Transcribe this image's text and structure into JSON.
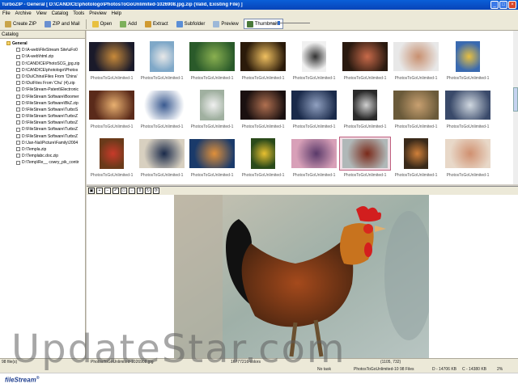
{
  "window": {
    "title": "TurboZIP - General [ D:\\CANDICE\\photologo\\PhotosToGoUnlimited-1026908.jpg.zip (Valid, Existing File) ]"
  },
  "menu": [
    "File",
    "Archive",
    "View",
    "Catalog",
    "Tools",
    "Preview",
    "Help"
  ],
  "toolbar": {
    "create_zip": "Create ZIP",
    "zip_mail": "ZIP and Mail",
    "open": "Open",
    "add": "Add",
    "extract": "Extract",
    "subfolder": "Subfolder",
    "preview": "Preview",
    "thumbnails": "Thumbnails"
  },
  "catalog": {
    "header": "Catalog",
    "root": "General",
    "items": [
      "D:\\A-web\\FileStream Site\\uFo0",
      "D:\\A-web\\html.zip",
      "D:\\CANDICE\\PhotoSCG_jpg.zip",
      "D:\\CANDICE\\photologo\\Photos",
      "D:\\Du\\China\\Files From 'China'",
      "D:\\Du\\Files From 'Chu' (4).zip",
      "D:\\FileStream-Patent\\Electronic",
      "D:\\FileStream Software\\Boomer",
      "D:\\FileStream Software\\BkZ.zip",
      "D:\\FileStream Software\\TurboS",
      "D:\\FileStream Software\\TurboZ",
      "D:\\FileStream Software\\TurboZ",
      "D:\\FileStream Software\\TurboZ",
      "D:\\FileStream Software\\TurboZ",
      "D:\\Jan-Nai\\Picture\\Family\\2004",
      "D:\\Templa.zip",
      "D:\\Templabc.doc.zip",
      "D:\\Temp\\Re__ cowry_pik_contir"
    ]
  },
  "thumb_caption": "PhotosToGoUnlimited-1",
  "thumbnails_count": 27,
  "status": {
    "files": "98 file(s)",
    "selected_file": "PhotosToGoUnlimited-1026908.jpg",
    "colors": "16777216 colors",
    "dims": "(1105, 732)",
    "task": "No task",
    "archive": "PhotosToGoUnlimited-10  98 Files",
    "d": "D - 14706 KB",
    "c": "C - 14380 KB",
    "pct": "2%"
  },
  "brand": {
    "name": "fileStream",
    "mark": "®"
  },
  "watermark": "UpdateStar.com",
  "colors": {
    "title_blue": "#0a5fd8",
    "chrome": "#ece9d8",
    "selection": "#c06080"
  }
}
